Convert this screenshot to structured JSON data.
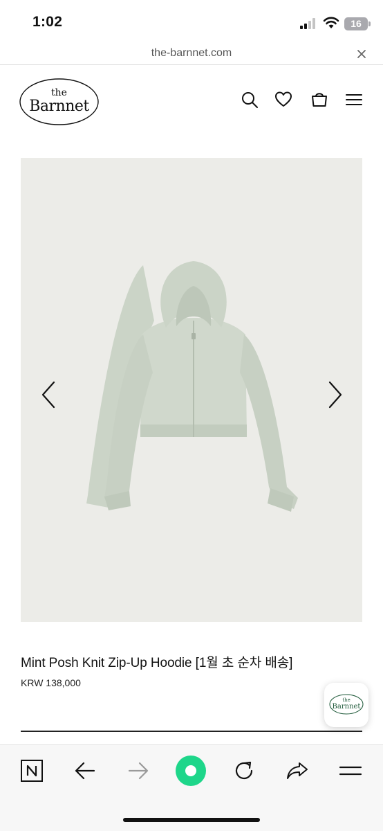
{
  "status": {
    "time": "1:02",
    "battery": "16"
  },
  "browser": {
    "url": "the-barnnet.com"
  },
  "site": {
    "logo_top": "the",
    "logo_main": "Barnnet"
  },
  "product": {
    "title": "Mint Posh Knit Zip-Up Hoodie [1월 초 순차 배송]",
    "price": "KRW 138,000",
    "image_bg": "#ecece8",
    "garment_color": "#c9d3c5"
  },
  "icons": {
    "header": [
      "search-icon",
      "heart-icon",
      "bag-icon",
      "menu-icon"
    ],
    "toolbar": [
      "n-home-icon",
      "back-arrow-icon",
      "forward-arrow-icon",
      "green-record-icon",
      "reload-icon",
      "share-icon",
      "menu-icon"
    ]
  },
  "colors": {
    "accent_green": "#1ed68a"
  }
}
